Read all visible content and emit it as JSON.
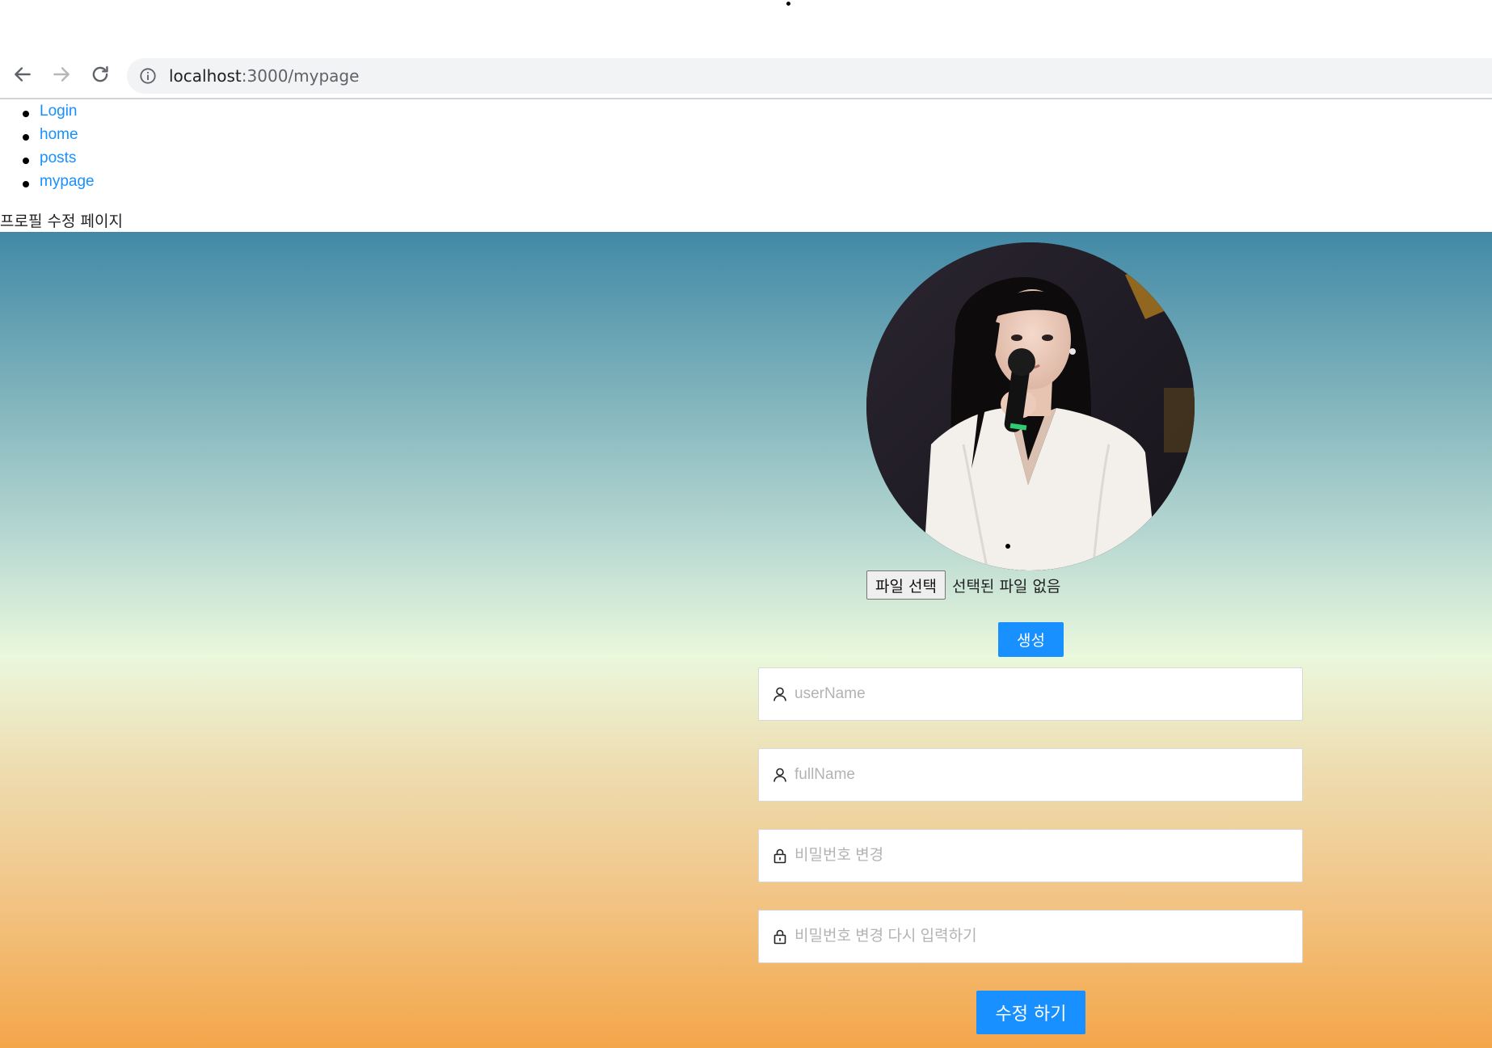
{
  "browser": {
    "url_host": "localhost",
    "url_path": ":3000/mypage"
  },
  "nav": {
    "items": [
      {
        "label": "Login"
      },
      {
        "label": "home"
      },
      {
        "label": "posts"
      },
      {
        "label": "mypage"
      }
    ]
  },
  "page": {
    "heading": "프로필 수정 페이지"
  },
  "profile": {
    "file_button": "파일 선택",
    "file_status": "선택된 파일 없음",
    "create_button": "생성"
  },
  "form": {
    "username_placeholder": "userName",
    "fullname_placeholder": "fullName",
    "password_placeholder": "비밀번호 변경",
    "password_confirm_placeholder": "비밀번호 변경 다시 입력하기",
    "submit_button": "수정 하기"
  },
  "colors": {
    "link": "#1890ff",
    "primary_button": "#1890ff"
  }
}
